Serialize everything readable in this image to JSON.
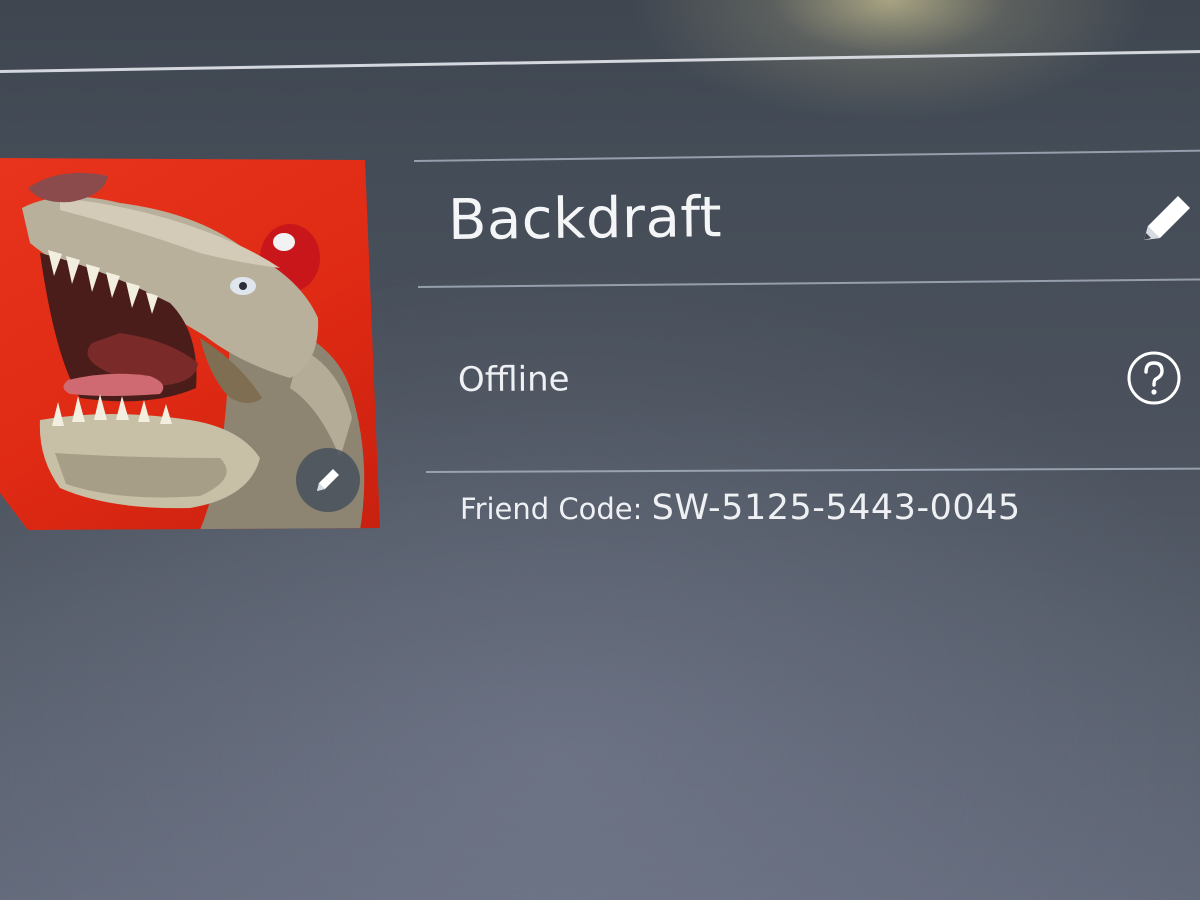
{
  "profile": {
    "nickname": "Backdraft",
    "status": "Offline",
    "friend_code_label": "Friend Code: ",
    "friend_code": "SW-5125-5443-0045"
  },
  "icons": {
    "edit_nickname": "pencil-icon",
    "edit_avatar": "pencil-icon",
    "status_help": "question-mark-icon"
  },
  "colors": {
    "avatar_background": "#e0291a",
    "text": "#f4f5f7"
  }
}
